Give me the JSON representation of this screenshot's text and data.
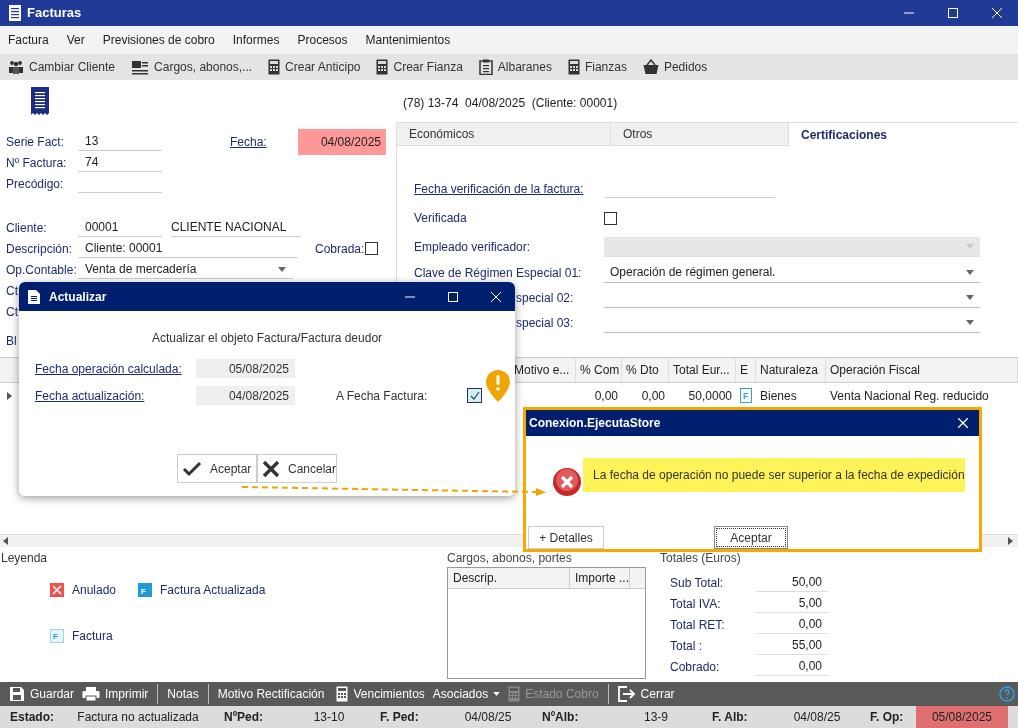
{
  "window": {
    "title": "Facturas"
  },
  "menu": [
    "Factura",
    "Ver",
    "Previsiones de cobro",
    "Informes",
    "Procesos",
    "Mantenimientos"
  ],
  "toolbar": [
    "Cambiar Cliente",
    "Cargos, abonos,...",
    "Crear Anticipo",
    "Crear Fianza",
    "Albaranes",
    "Fianzas",
    "Pedidos"
  ],
  "summary": "(78) 13-74  04/08/2025  (Cliente: 00001)",
  "form": {
    "serie_label": "Serie Fact:",
    "serie": "13",
    "numero_label": "Nº Factura:",
    "numero": "74",
    "precodigo_label": "Precódigo:",
    "fecha_label": "Fecha:",
    "fecha": "04/08/2025",
    "fecha_invalid": true,
    "cliente_label": "Cliente:",
    "cliente_code": "00001",
    "cliente_name": "CLIENTE NACIONAL",
    "descripcion_label": "Descripción:",
    "descripcion": "Cliente: 00001",
    "cobrada_label": "Cobrada:",
    "cobrada_checked": false,
    "op_label": "Op.Contable:",
    "op": "Venta de mercadería",
    "cut_labels": [
      "Ct",
      "Ct",
      "Bl"
    ]
  },
  "tabs": [
    {
      "label": "Económicos",
      "selected": false
    },
    {
      "label": "Otros",
      "selected": false
    },
    {
      "label": "Certificaciones",
      "selected": true
    }
  ],
  "certificaciones": [
    {
      "kind": "date",
      "label": "Fecha verificación de la factura:"
    },
    {
      "kind": "checkbox",
      "label": "Verificada",
      "checked": false
    },
    {
      "kind": "select",
      "label": "Empleado verificador:",
      "disabled": true
    },
    {
      "kind": "select",
      "label": "Clave de Régimen Especial 01:",
      "value": "Operación de régimen general.",
      "disabled": false
    },
    {
      "kind": "select",
      "label_tail": "special 02:",
      "disabled": false
    },
    {
      "kind": "select",
      "label_tail": "special 03:",
      "disabled": false
    }
  ],
  "grid": {
    "columns": [
      "Motivo e...",
      "% Com",
      "% Dto",
      "Total Eur...",
      "E",
      "Naturaleza",
      "Operación Fiscal"
    ],
    "rows": [
      {
        "cells": [
          "",
          "0,00",
          "0,00",
          "50,0000",
          "F",
          "Bienes",
          "Venta Nacional Reg. reducido"
        ]
      }
    ]
  },
  "legend": {
    "title": "Leyenda",
    "items": [
      {
        "kind": "anulado",
        "label": "Anulado"
      },
      {
        "kind": "actualizada",
        "badge": "F",
        "label": "Factura Actualizada"
      },
      {
        "kind": "factura",
        "badge": "F",
        "label": "Factura"
      }
    ]
  },
  "cargos": {
    "title": "Cargos, abonos, portes",
    "columns": [
      "Descrip.",
      "Importe ..."
    ]
  },
  "totales": {
    "title": "Totales (Euros)",
    "rows": [
      {
        "label": "Sub Total:",
        "value": "50,00"
      },
      {
        "label": "Total IVA:",
        "value": "5,00"
      },
      {
        "label": "Total RET:",
        "value": "0,00"
      },
      {
        "label": "Total :",
        "value": "55,00"
      },
      {
        "label": "Cobrado:",
        "value": "0,00"
      }
    ]
  },
  "bottom_toolbar": [
    {
      "label": "Guardar",
      "disabled": false,
      "dropdown": false
    },
    {
      "label": "Imprimir",
      "disabled": false,
      "dropdown": false
    },
    {
      "label": "Notas",
      "disabled": false,
      "dropdown": false
    },
    {
      "label": "Motivo Rectificación",
      "disabled": false,
      "dropdown": false
    },
    {
      "label": "Vencimientos",
      "disabled": false,
      "dropdown": false
    },
    {
      "label": "Asociados",
      "disabled": false,
      "dropdown": true
    },
    {
      "label": "Estado Cobro",
      "disabled": true,
      "dropdown": false
    },
    {
      "label": "Cerrar",
      "disabled": false,
      "dropdown": false
    }
  ],
  "status_bar": [
    {
      "label": "Estado:",
      "value": "Factura no actualizada",
      "highlighted": false
    },
    {
      "label": "NºPed:",
      "value": "13-10",
      "highlighted": false
    },
    {
      "label": "F. Ped:",
      "value": "04/08/25",
      "highlighted": false
    },
    {
      "label": "NºAlb:",
      "value": "13-9",
      "highlighted": false
    },
    {
      "label": "F. Alb:",
      "value": "04/08/25",
      "highlighted": false
    },
    {
      "label": "F. Op:",
      "value": "05/08/2025",
      "highlighted": true
    }
  ],
  "update_dialog": {
    "title": "Actualizar",
    "message": "Actualizar el objeto Factura/Factura deudor",
    "fields": [
      {
        "label": "Fecha operación calculada:",
        "value": "05/08/2025"
      },
      {
        "label": "Fecha actualización:",
        "value": "04/08/2025"
      }
    ],
    "a_fecha_label": "A Fecha Factura:",
    "a_fecha_checked": true,
    "buttons": [
      "Aceptar",
      "Cancelar"
    ]
  },
  "error_dialog": {
    "title": "Conexion.EjecutaStore",
    "message": "La fecha de operación no puede ser superior a la fecha de expedición",
    "buttons": [
      "+ Detalles",
      "Aceptar"
    ]
  }
}
